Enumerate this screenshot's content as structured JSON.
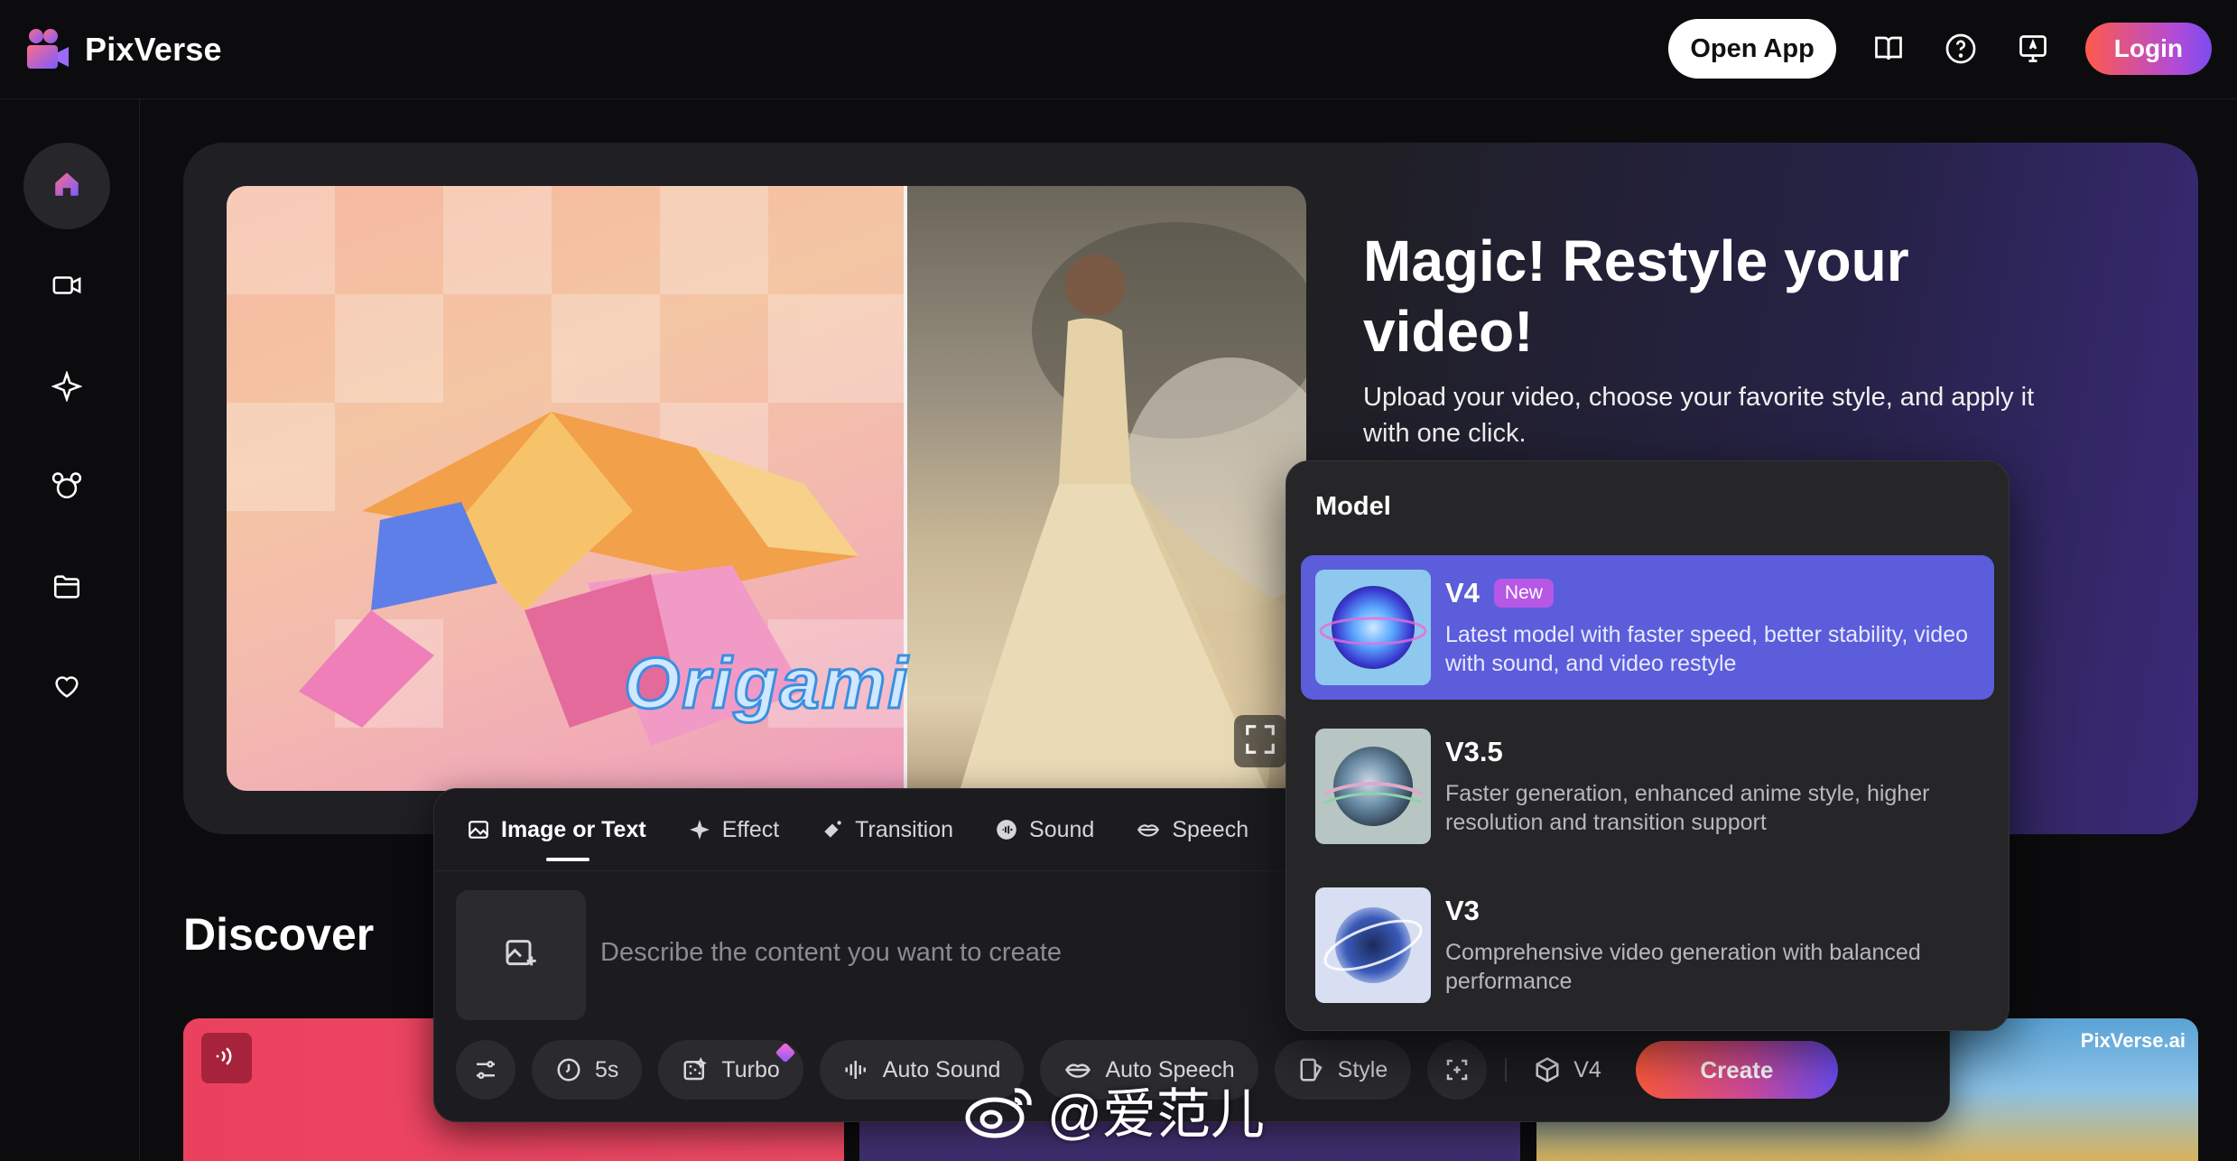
{
  "brand": {
    "name": "PixVerse"
  },
  "header": {
    "open_app_label": "Open App",
    "login_label": "Login",
    "icons": [
      "book-icon",
      "help-icon",
      "feedback-icon"
    ]
  },
  "sidebar": {
    "items": [
      {
        "icon": "home-icon",
        "active": true
      },
      {
        "icon": "video-icon",
        "active": false
      },
      {
        "icon": "sparkle-icon",
        "active": false
      },
      {
        "icon": "character-icon",
        "active": false
      },
      {
        "icon": "folder-icon",
        "active": false
      },
      {
        "icon": "heart-icon",
        "active": false
      }
    ]
  },
  "hero": {
    "title": "Magic! Restyle your video!",
    "subtitle": "Upload your video, choose your favorite style, and apply it with one click.",
    "media_label": "Origami",
    "slide_dots": 2
  },
  "discover": {
    "title": "Discover",
    "card_watermark": "PixVerse.ai"
  },
  "composer": {
    "tabs": [
      {
        "label": "Image or Text",
        "icon": "image-icon",
        "active": true
      },
      {
        "label": "Effect",
        "icon": "sparkle-icon",
        "active": false
      },
      {
        "label": "Transition",
        "icon": "transition-icon",
        "active": false
      },
      {
        "label": "Sound",
        "icon": "sound-icon",
        "active": false
      },
      {
        "label": "Speech",
        "icon": "lips-icon",
        "active": false
      }
    ],
    "prompt_placeholder": "Describe the content you want to create",
    "toolbar": {
      "duration": "5s",
      "turbo": "Turbo",
      "auto_sound": "Auto Sound",
      "auto_speech": "Auto Speech",
      "style": "Style",
      "model": "V4",
      "create": "Create"
    }
  },
  "model_menu": {
    "heading": "Model",
    "items": [
      {
        "name": "V4",
        "badge": "New",
        "description": "Latest model with faster speed, better stability, video with sound, and video restyle",
        "selected": true
      },
      {
        "name": "V3.5",
        "badge": "",
        "description": "Faster generation, enhanced anime style, higher resolution and transition support",
        "selected": false
      },
      {
        "name": "V3",
        "badge": "",
        "description": "Comprehensive video generation with balanced performance",
        "selected": false
      }
    ]
  },
  "overlay_watermark": "@爱范儿",
  "colors": {
    "background": "#0c0c0e",
    "selected_model": "#5b5ddb",
    "badge_new": "#b657e6",
    "accent_gradient_start": "#ff5a3c",
    "accent_gradient_end": "#6a4cf2"
  }
}
